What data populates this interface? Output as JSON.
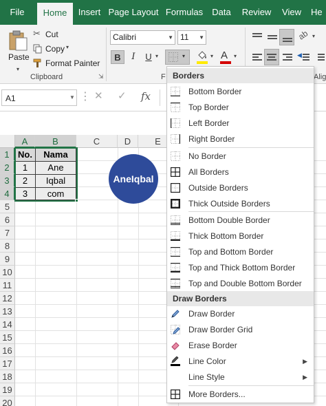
{
  "ribbon_tabs": [
    "File",
    "Home",
    "Insert",
    "Page Layout",
    "Formulas",
    "Data",
    "Review",
    "View",
    "He"
  ],
  "clipboard": {
    "paste_label": "Paste",
    "cut_label": "Cut",
    "copy_label": "Copy",
    "format_painter_label": "Format Painter",
    "group_label": "Clipboard"
  },
  "font": {
    "name": "Calibri",
    "size": "11",
    "bold": "B",
    "italic": "I",
    "underline": "U",
    "group_label_partial": "F",
    "color_glyph": "A"
  },
  "alignment": {
    "group_label_partial": "Align"
  },
  "formula_bar": {
    "name_box": "A1",
    "fx": "fx",
    "value": ""
  },
  "sheet": {
    "columns": [
      "A",
      "B",
      "C",
      "D",
      "E"
    ],
    "rows": [
      "1",
      "2",
      "3",
      "4",
      "5",
      "6",
      "7",
      "8",
      "9",
      "10",
      "11",
      "12",
      "13",
      "14",
      "15",
      "16",
      "17",
      "18",
      "19",
      "20"
    ],
    "table": {
      "headers": [
        "No.",
        "Nama"
      ],
      "rows": [
        [
          "1",
          "Ane"
        ],
        [
          "2",
          "Iqbal"
        ],
        [
          "3",
          "com"
        ]
      ]
    },
    "logo_text": "AneIqbal"
  },
  "borders_menu": {
    "header": "Borders",
    "items": [
      {
        "label": "Bottom Border",
        "icon": "bottom-border-icon"
      },
      {
        "label": "Top Border",
        "icon": "top-border-icon"
      },
      {
        "label": "Left Border",
        "icon": "left-border-icon"
      },
      {
        "label": "Right Border",
        "icon": "right-border-icon"
      },
      {
        "label": "No Border",
        "icon": "no-border-icon"
      },
      {
        "label": "All Borders",
        "icon": "all-borders-icon"
      },
      {
        "label": "Outside Borders",
        "icon": "outside-borders-icon"
      },
      {
        "label": "Thick Outside Borders",
        "icon": "thick-outside-borders-icon"
      },
      {
        "label": "Bottom Double Border",
        "icon": "bottom-double-border-icon"
      },
      {
        "label": "Thick Bottom Border",
        "icon": "thick-bottom-border-icon"
      },
      {
        "label": "Top and Bottom Border",
        "icon": "top-and-bottom-border-icon"
      },
      {
        "label": "Top and Thick Bottom Border",
        "icon": "top-and-thick-bottom-border-icon"
      },
      {
        "label": "Top and Double Bottom Border",
        "icon": "top-and-double-bottom-border-icon"
      }
    ],
    "draw_header": "Draw Borders",
    "draw_items": [
      {
        "label": "Draw Border",
        "icon": "pencil-icon"
      },
      {
        "label": "Draw Border Grid",
        "icon": "grid-pencil-icon"
      },
      {
        "label": "Erase Border",
        "icon": "eraser-icon"
      },
      {
        "label": "Line Color",
        "icon": "line-color-icon"
      },
      {
        "label": "Line Style",
        "icon": "line-style-icon"
      }
    ],
    "more_label": "More Borders...",
    "more_icon": "more-borders-icon"
  },
  "colors": {
    "excel_green": "#217346",
    "logo_blue": "#2e4b9a",
    "header_fill": "#d9d9d9",
    "font_color_underline": "#d40000",
    "fill_color_underline": "#ffea00"
  }
}
